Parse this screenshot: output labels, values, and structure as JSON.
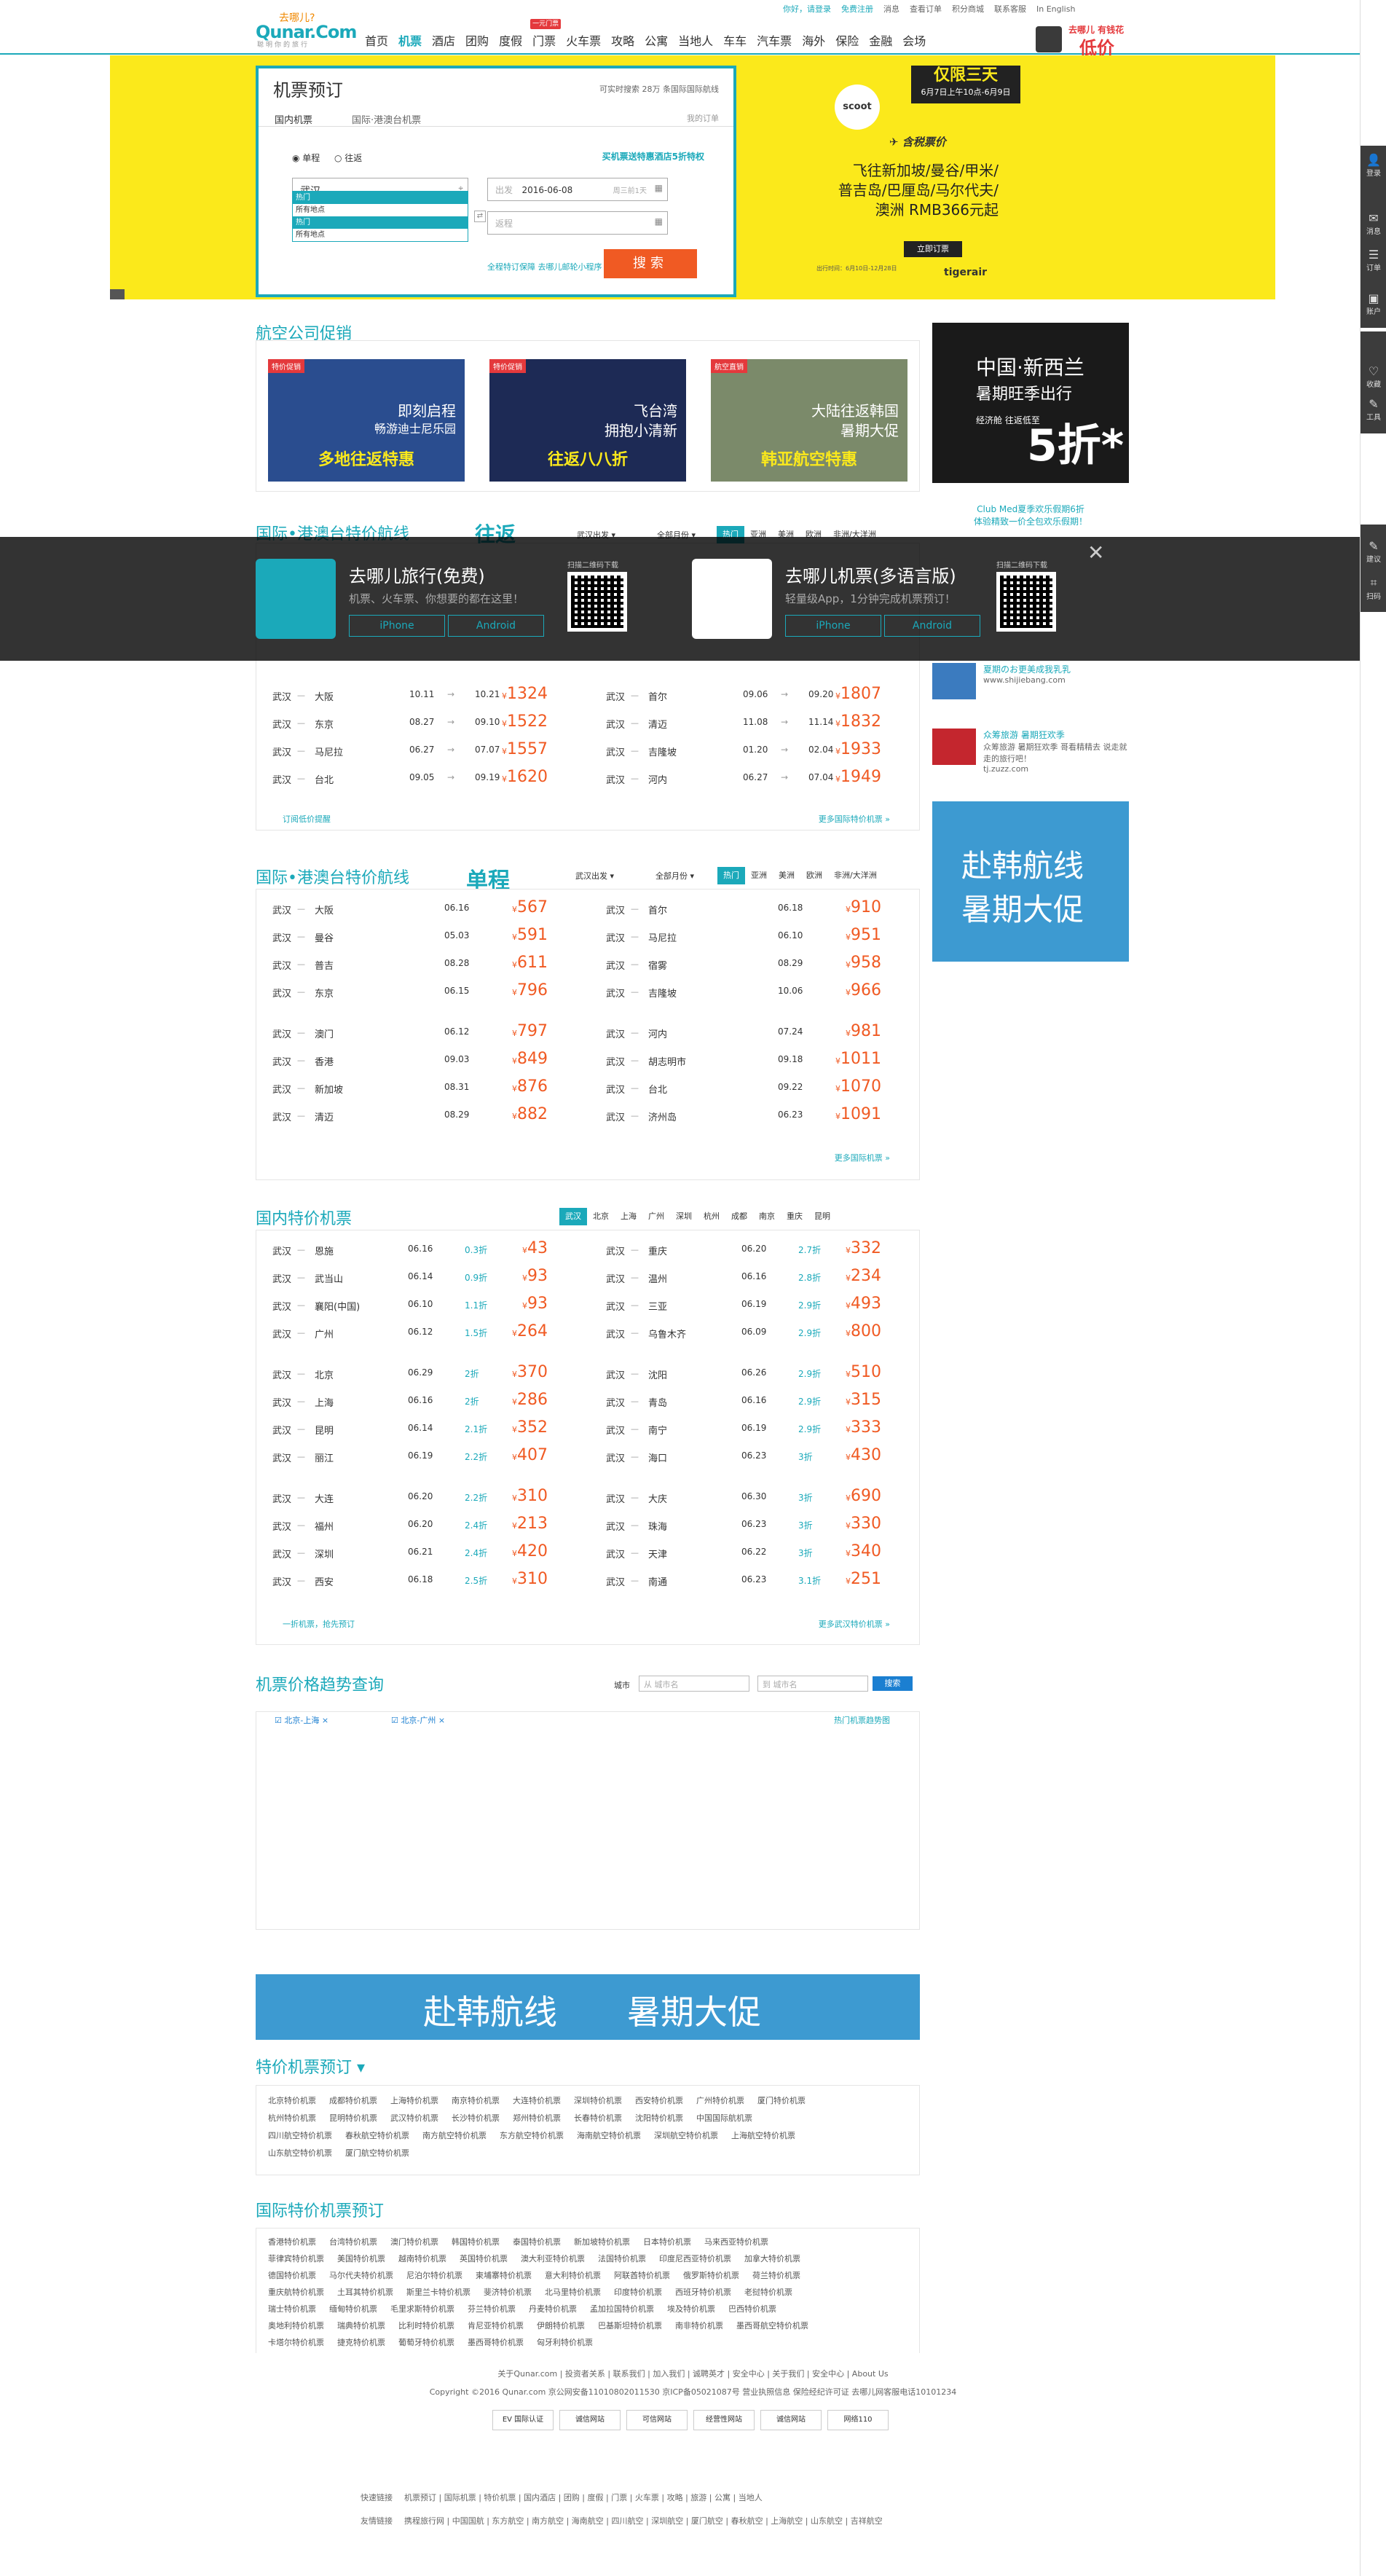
{
  "header": {
    "logo_cn": "去哪儿?",
    "logo_en": "Qunar.Com",
    "logo_sub": "聪明你的旅行",
    "nav": [
      "首页",
      "机票",
      "酒店",
      "团购",
      "度假",
      "门票",
      "火车票",
      "攻略",
      "公寓",
      "当地人",
      "车车",
      "汽车票",
      "海外",
      "保险",
      "金融",
      "会场"
    ],
    "nav_tag": "一元门票",
    "toplinks": [
      "你好，请登录",
      "免费注册",
      "消息",
      "查看订单",
      "积分商城",
      "联系客服",
      "In English"
    ],
    "promo_t1": "去哪儿 有钱花",
    "promo_t2": "低价"
  },
  "booking": {
    "title": "机票预订",
    "notice": "可实时搜索 28万 条国际国际航线",
    "notice_num": "28万",
    "tab_domestic": "国内机票",
    "tab_intl": "国际·港澳台机票",
    "my_ticket": "我的订单",
    "radio_one": "单程",
    "radio_round": "往返",
    "hotel_link": "买机票送特惠酒店5折特权",
    "from_value": "武汉",
    "to_placeholder": "",
    "dd_items": [
      "热门",
      "所有地点",
      "热门",
      "所有地点"
    ],
    "depart_label": "出发",
    "depart_value": "2016-06-08",
    "depart_hint": "周三前1天",
    "return_label": "返程",
    "search_btn": "搜索",
    "bottom_link": "全程特订保障 去哪儿邮轮小程序"
  },
  "scoot": {
    "logo": "scoot",
    "box_t1": "仅限三天",
    "box_t2": "6月7日上午10点-6月9日",
    "head": "含税票价",
    "dest": [
      "飞往新加坡/曼谷/甲米/",
      "普吉岛/巴厘岛/马尔代夫/",
      "澳洲 RMB366元起"
    ],
    "btn": "立即订票",
    "tiger": "tigerair",
    "fine": "出行时间：6月10日-12月28日"
  },
  "airline": {
    "title": "航空公司促销",
    "promos": [
      {
        "label": "特价促销",
        "t1": "即刻启程",
        "t2": "畅游迪士尼乐园",
        "t3": "多地往返特惠"
      },
      {
        "label": "特价促销",
        "t1": "飞台湾",
        "t2": "拥抱小清新",
        "t3": "往返八八折"
      },
      {
        "label": "航空直销",
        "t1": "大陆往返韩国",
        "t2": "暑期大促",
        "t3": "韩亚航空特惠"
      }
    ]
  },
  "ad_nz": {
    "t1": "中国·新西兰",
    "t2": "暑期旺季出行",
    "t3": "5折*",
    "t4": "经济舱 往返低至"
  },
  "overlay": {
    "app1_name": "去哪儿旅行(免费)",
    "app1_desc": "机票、火车票、你想要的都在这里！",
    "app2_name": "去哪儿机票(多语言版)",
    "app2_desc": "轻量级App，1分钟完成机票预订！",
    "iphone": "iPhone",
    "android": "Android",
    "qr_label": "扫描二维码下载"
  },
  "round_section": {
    "title": "国际•港澳台特价航线",
    "badge": "往返",
    "from": "武汉出发",
    "month": "全部月份",
    "tabs": [
      "热门",
      "亚洲",
      "美洲",
      "欧洲",
      "非洲/大洋洲"
    ],
    "left": [
      {
        "from": "武汉",
        "to": "大阪",
        "d1": "10.11",
        "d2": "10.21",
        "price": "1324"
      },
      {
        "from": "武汉",
        "to": "东京",
        "d1": "08.27",
        "d2": "09.10",
        "price": "1522"
      },
      {
        "from": "武汉",
        "to": "马尼拉",
        "d1": "06.27",
        "d2": "07.07",
        "price": "1557"
      },
      {
        "from": "武汉",
        "to": "台北",
        "d1": "09.05",
        "d2": "09.19",
        "price": "1620"
      }
    ],
    "right": [
      {
        "from": "武汉",
        "to": "首尔",
        "d1": "09.06",
        "d2": "09.20",
        "price": "1807"
      },
      {
        "from": "武汉",
        "to": "清迈",
        "d1": "11.08",
        "d2": "11.14",
        "price": "1832"
      },
      {
        "from": "武汉",
        "to": "吉隆坡",
        "d1": "01.20",
        "d2": "02.04",
        "price": "1933"
      },
      {
        "from": "武汉",
        "to": "河内",
        "d1": "06.27",
        "d2": "07.04",
        "price": "1949"
      }
    ],
    "sub": "订阅低价提醒",
    "more": "更多国际特价机票"
  },
  "oneway_section": {
    "title": "国际•港澳台特价航线",
    "badge": "单程",
    "from": "武汉出发",
    "month": "全部月份",
    "tabs": [
      "热门",
      "亚洲",
      "美洲",
      "欧洲",
      "非洲/大洋洲"
    ],
    "left": [
      {
        "from": "武汉",
        "to": "大阪",
        "d": "06.16",
        "price": "567"
      },
      {
        "from": "武汉",
        "to": "曼谷",
        "d": "05.03",
        "price": "591"
      },
      {
        "from": "武汉",
        "to": "普吉",
        "d": "08.28",
        "price": "611"
      },
      {
        "from": "武汉",
        "to": "东京",
        "d": "06.15",
        "price": "796"
      },
      {
        "from": "武汉",
        "to": "澳门",
        "d": "06.12",
        "price": "797"
      },
      {
        "from": "武汉",
        "to": "香港",
        "d": "09.03",
        "price": "849"
      },
      {
        "from": "武汉",
        "to": "新加坡",
        "d": "08.31",
        "price": "876"
      },
      {
        "from": "武汉",
        "to": "清迈",
        "d": "08.29",
        "price": "882"
      }
    ],
    "right": [
      {
        "from": "武汉",
        "to": "首尔",
        "d": "06.18",
        "price": "910"
      },
      {
        "from": "武汉",
        "to": "马尼拉",
        "d": "06.10",
        "price": "951"
      },
      {
        "from": "武汉",
        "to": "宿雾",
        "d": "08.29",
        "price": "958"
      },
      {
        "from": "武汉",
        "to": "吉隆坡",
        "d": "10.06",
        "price": "966"
      },
      {
        "from": "武汉",
        "to": "河内",
        "d": "07.24",
        "price": "981"
      },
      {
        "from": "武汉",
        "to": "胡志明市",
        "d": "09.18",
        "price": "1011"
      },
      {
        "from": "武汉",
        "to": "台北",
        "d": "09.22",
        "price": "1070"
      },
      {
        "from": "武汉",
        "to": "济州岛",
        "d": "06.23",
        "price": "1091"
      }
    ],
    "more": "更多国际机票"
  },
  "domestic_section": {
    "title": "国内特价机票",
    "tabs": [
      "武汉",
      "北京",
      "上海",
      "广州",
      "深圳",
      "杭州",
      "成都",
      "南京",
      "重庆",
      "昆明"
    ],
    "left": [
      {
        "from": "武汉",
        "to": "恩施",
        "d": "06.16",
        "dis": "0.3折",
        "price": "43"
      },
      {
        "from": "武汉",
        "to": "武当山",
        "d": "06.14",
        "dis": "0.9折",
        "price": "93"
      },
      {
        "from": "武汉",
        "to": "襄阳(中国)",
        "d": "06.10",
        "dis": "1.1折",
        "price": "93"
      },
      {
        "from": "武汉",
        "to": "广州",
        "d": "06.12",
        "dis": "1.5折",
        "price": "264"
      },
      {
        "from": "武汉",
        "to": "北京",
        "d": "06.29",
        "dis": "2折",
        "price": "370"
      },
      {
        "from": "武汉",
        "to": "上海",
        "d": "06.16",
        "dis": "2折",
        "price": "286"
      },
      {
        "from": "武汉",
        "to": "昆明",
        "d": "06.14",
        "dis": "2.1折",
        "price": "352"
      },
      {
        "from": "武汉",
        "to": "丽江",
        "d": "06.19",
        "dis": "2.2折",
        "price": "407"
      },
      {
        "from": "武汉",
        "to": "大连",
        "d": "06.20",
        "dis": "2.2折",
        "price": "310"
      },
      {
        "from": "武汉",
        "to": "福州",
        "d": "06.20",
        "dis": "2.4折",
        "price": "213"
      },
      {
        "from": "武汉",
        "to": "深圳",
        "d": "06.21",
        "dis": "2.4折",
        "price": "420"
      },
      {
        "from": "武汉",
        "to": "西安",
        "d": "06.18",
        "dis": "2.5折",
        "price": "310"
      }
    ],
    "right": [
      {
        "from": "武汉",
        "to": "重庆",
        "d": "06.20",
        "dis": "2.7折",
        "price": "332"
      },
      {
        "from": "武汉",
        "to": "温州",
        "d": "06.16",
        "dis": "2.8折",
        "price": "234"
      },
      {
        "from": "武汉",
        "to": "三亚",
        "d": "06.19",
        "dis": "2.9折",
        "price": "493"
      },
      {
        "from": "武汉",
        "to": "乌鲁木齐",
        "d": "06.09",
        "dis": "2.9折",
        "price": "800"
      },
      {
        "from": "武汉",
        "to": "沈阳",
        "d": "06.26",
        "dis": "2.9折",
        "price": "510"
      },
      {
        "from": "武汉",
        "to": "青岛",
        "d": "06.16",
        "dis": "2.9折",
        "price": "315"
      },
      {
        "from": "武汉",
        "to": "南宁",
        "d": "06.19",
        "dis": "2.9折",
        "price": "333"
      },
      {
        "from": "武汉",
        "to": "海口",
        "d": "06.23",
        "dis": "3折",
        "price": "430"
      },
      {
        "from": "武汉",
        "to": "大庆",
        "d": "06.30",
        "dis": "3折",
        "price": "690"
      },
      {
        "from": "武汉",
        "to": "珠海",
        "d": "06.23",
        "dis": "3折",
        "price": "330"
      },
      {
        "from": "武汉",
        "to": "天津",
        "d": "06.22",
        "dis": "3折",
        "price": "340"
      },
      {
        "from": "武汉",
        "to": "南通",
        "d": "06.23",
        "dis": "3.1折",
        "price": "251"
      }
    ],
    "sub": "一折机票，抢先预订",
    "more": "更多武汉特价机票"
  },
  "right_ads": [
    {
      "t": "Club Med夏季欢乐假期6折",
      "s": "体验精致一价全包欢乐假期！"
    },
    {
      "t": "夏期のお更美成我乳乳",
      "s": "www.shijiebang.com"
    },
    {
      "t": "众筹旅游 暑期狂欢季",
      "s": "众筹旅游 暑期狂欢季 哥看精精去 说走就走的旅行吧！"
    },
    {
      "t": "",
      "s": "tj.zuzz.com"
    }
  ],
  "korea_ad": {
    "t1": "赴韩航线",
    "t2": "暑期大促"
  },
  "trend": {
    "title": "机票价格趋势查询",
    "city_label": "城市",
    "from_ph": "从  城市名",
    "to_ph": "到  城市名",
    "btn": "搜索",
    "chip1": "北京-上海",
    "chip2": "北京-广州",
    "hot": "热门机票趋势图"
  },
  "bottom_banner": {
    "t1": "赴韩航线",
    "t2": "暑期大促"
  },
  "special": {
    "title": "特价机票预订",
    "rows": [
      [
        "北京特价机票",
        "成都特价机票",
        "上海特价机票",
        "南京特价机票",
        "大连特价机票",
        "深圳特价机票",
        "西安特价机票",
        "广州特价机票",
        "厦门特价机票"
      ],
      [
        "杭州特价机票",
        "昆明特价机票",
        "武汉特价机票",
        "长沙特价机票",
        "郑州特价机票",
        "长春特价机票",
        "沈阳特价机票",
        "中国国际航机票"
      ],
      [
        "四川航空特价机票",
        "春秋航空特价机票",
        "南方航空特价机票",
        "东方航空特价机票",
        "海南航空特价机票",
        "深圳航空特价机票",
        "上海航空特价机票"
      ],
      [
        "山东航空特价机票",
        "厦门航空特价机票"
      ]
    ]
  },
  "intl": {
    "title": "国际特价机票预订",
    "rows": [
      [
        "香港特价机票",
        "台湾特价机票",
        "澳门特价机票",
        "韩国特价机票",
        "泰国特价机票",
        "新加坡特价机票",
        "日本特价机票",
        "马来西亚特价机票"
      ],
      [
        "菲律宾特价机票",
        "美国特价机票",
        "越南特价机票",
        "英国特价机票",
        "澳大利亚特价机票",
        "法国特价机票",
        "印度尼西亚特价机票",
        "加拿大特价机票"
      ],
      [
        "德国特价机票",
        "马尔代夫特价机票",
        "尼泊尔特价机票",
        "柬埔寨特价机票",
        "意大利特价机票",
        "阿联酋特价机票",
        "俄罗斯特价机票",
        "荷兰特价机票"
      ],
      [
        "重庆航特价机票",
        "土耳其特价机票",
        "斯里兰卡特价机票",
        "斐济特价机票",
        "北马里特价机票",
        "印度特价机票",
        "西班牙特价机票",
        "老挝特价机票"
      ],
      [
        "瑞士特价机票",
        "缅甸特价机票",
        "毛里求斯特价机票",
        "芬兰特价机票",
        "丹麦特价机票",
        "孟加拉国特价机票",
        "埃及特价机票",
        "巴西特价机票"
      ],
      [
        "奥地利特价机票",
        "瑞典特价机票",
        "比利时特价机票",
        "肯尼亚特价机票",
        "伊朗特价机票",
        "巴基斯坦特价机票",
        "南非特价机票",
        "墨西哥航空特价机票"
      ],
      [
        "卡塔尔特价机票",
        "捷克特价机票",
        "葡萄牙特价机票",
        "墨西哥特价机票",
        "匈牙利特价机票"
      ]
    ]
  },
  "footer": {
    "links": "关于Qunar.com | 投资者关系 | 联系我们 | 加入我们 | 诚聘英才 | 安全中心 | 关于我们 | 安全中心 | About Us",
    "copy": "Copyright ©2016 Qunar.com  京公网安备11010802011530  京ICP备05021087号  营业执照信息  保险经纪许可证  去哪儿网客服电话10101234",
    "badges": [
      "EV 国际认证",
      "诚信网站",
      "可信网站",
      "经营性网站",
      "诚信网站",
      "网络110"
    ],
    "quick_label": "快速链接",
    "friend_label": "友情链接",
    "quick": "机票预订 | 国际机票 | 特价机票 | 国内酒店 | 团购 | 度假 | 门票 | 火车票 | 攻略 | 旅游 | 公寓 | 当地人",
    "friend": "携程旅行网 | 中国国航 | 东方航空 | 南方航空 | 海南航空 | 四川航空 | 深圳航空 | 厦门航空 | 春秋航空 | 上海航空 | 山东航空 | 吉祥航空"
  },
  "sidebar": [
    "登录",
    "消息",
    "订单",
    "账户",
    "收藏",
    "工具",
    "建议",
    "扫码"
  ]
}
